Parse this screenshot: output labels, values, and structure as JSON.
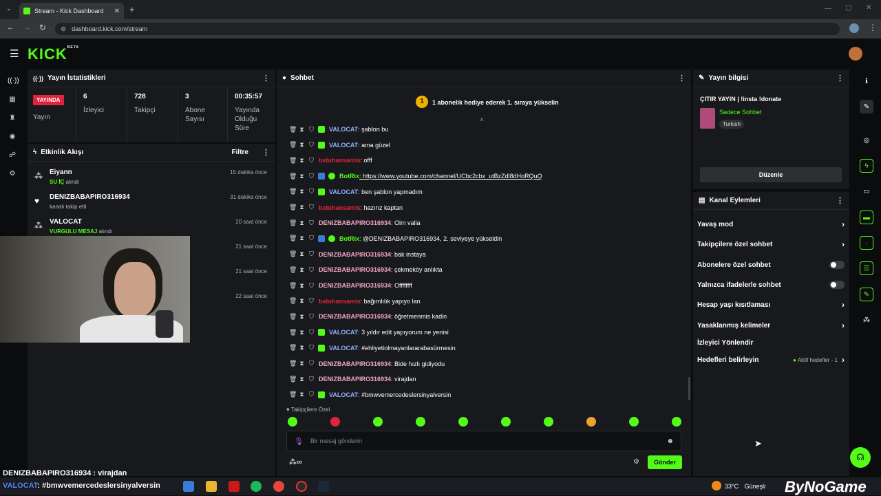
{
  "browser": {
    "tab_title": "Stream - Kick Dashboard",
    "url": "dashboard.kick.com/stream"
  },
  "brand": {
    "logo": "KICK",
    "beta": "BETA",
    "accent": "#53fc18"
  },
  "stats": {
    "title": "Yayın İstatistikleri",
    "live_badge": "YAYINDA",
    "live_label": "Yayın",
    "cells": [
      {
        "value": "6",
        "label": "İzleyici"
      },
      {
        "value": "728",
        "label": "Takipçi"
      },
      {
        "value": "3",
        "label": "Abone Sayısı"
      },
      {
        "value": "00:35:57",
        "label": "Yayında Olduğu Süre"
      }
    ]
  },
  "activity": {
    "title": "Etkinlik Akışı",
    "filter": "Filtre",
    "items": [
      {
        "name": "Eiyann",
        "highlight": "SU İÇ",
        "desc": " alındı",
        "time": "15 dakika önce"
      },
      {
        "name": "DENIZBABAPIRO316934",
        "highlight": "",
        "desc": "kanalı takip etti",
        "time": "31 dakika önce"
      },
      {
        "name": "VALOCAT",
        "highlight": "VURGULU MESAJ",
        "desc": " alındı",
        "time": "20 saat önce"
      },
      {
        "name": "",
        "highlight": "",
        "desc": "",
        "time": "21 saat önce"
      },
      {
        "name": "",
        "highlight": "",
        "desc": "",
        "time": "21 saat önce"
      },
      {
        "name": "",
        "highlight": "",
        "desc": "",
        "time": "22 saat önce"
      }
    ]
  },
  "chat": {
    "title": "Sohbet",
    "pinned_rank": "1",
    "pinned_text": "1 abonelik hediye ederek 1. sıraya yükselin",
    "messages": [
      {
        "user": "VALOCAT",
        "color": "#8fb4ff",
        "badge": "sub",
        "text": ": şablon bu"
      },
      {
        "user": "VALOCAT",
        "color": "#8fb4ff",
        "badge": "sub",
        "text": ": ama güzel"
      },
      {
        "user": "batuhansamis",
        "color": "#e0233d",
        "badge": "",
        "text": ": offf"
      },
      {
        "user": "BotRix",
        "color": "#53fc18",
        "badge": "bot",
        "text": ": https://www.youtube.com/channel/UCbc2cbx_utBzZdl8dHoRQuQ"
      },
      {
        "user": "VALOCAT",
        "color": "#8fb4ff",
        "badge": "sub",
        "text": ": ben şablon yapmadım"
      },
      {
        "user": "batuhansamis",
        "color": "#e0233d",
        "badge": "",
        "text": ": hazırız kaptan"
      },
      {
        "user": "DENIZBABAPIRO316934",
        "color": "#f2a6c4",
        "badge": "",
        "text": ": Olm valla"
      },
      {
        "user": "BotRix",
        "color": "#53fc18",
        "badge": "bot",
        "text": ": @DENIZBABAPIRO316934, 2. seviyeye yükseldin"
      },
      {
        "user": "DENIZBABAPIRO316934",
        "color": "#f2a6c4",
        "badge": "",
        "text": ": bak instaya"
      },
      {
        "user": "DENIZBABAPIRO316934",
        "color": "#f2a6c4",
        "badge": "",
        "text": ": çekmeköy anlıkta"
      },
      {
        "user": "DENIZBABAPIRO316934",
        "color": "#f2a6c4",
        "badge": "",
        "text": ": Offffffff"
      },
      {
        "user": "batuhansamis",
        "color": "#e0233d",
        "badge": "",
        "text": ": bağımlılık yapıyo lan"
      },
      {
        "user": "DENIZBABAPIRO316934",
        "color": "#f2a6c4",
        "badge": "",
        "text": ": öğretmenmis kadin"
      },
      {
        "user": "VALOCAT",
        "color": "#8fb4ff",
        "badge": "sub",
        "text": ": 3 yıldır edit yapıyorum ne yenisi"
      },
      {
        "user": "VALOCAT",
        "color": "#8fb4ff",
        "badge": "sub",
        "text": ": #ehliyetiolmayanlararabasürmesin"
      },
      {
        "user": "DENIZBABAPIRO316934",
        "color": "#f2a6c4",
        "badge": "",
        "text": ": Bide hızlı gidiyodu"
      },
      {
        "user": "DENIZBABAPIRO316934",
        "color": "#f2a6c4",
        "badge": "",
        "text": ": virajdan"
      },
      {
        "user": "VALOCAT",
        "color": "#8fb4ff",
        "badge": "sub",
        "text": ": #bmwvemercedeslersinyalversin"
      }
    ],
    "followers_only": "Takipçilere Özel",
    "input_placeholder": "Bir mesaj gönderin",
    "send": "Gönder",
    "infinity": "∞"
  },
  "stream_info": {
    "title": "Yayın bilgisi",
    "stream_title": "ÇITIR YAYIN | !insta !donate",
    "category": "Sadece Sohbet",
    "language": "Turkish",
    "edit": "Düzenle"
  },
  "channel_actions": {
    "title": "Kanal Eylemleri",
    "items": [
      {
        "label": "Yavaş mod",
        "control": "chevron"
      },
      {
        "label": "Takipçilere özel sohbet",
        "control": "chevron"
      },
      {
        "label": "Abonelere özel sohbet",
        "control": "toggle"
      },
      {
        "label": "Yalnızca ifadelerle sohbet",
        "control": "toggle"
      },
      {
        "label": "Hesap yaşı kısıtlaması",
        "control": "chevron"
      },
      {
        "label": "Yasaklanmış kelimeler",
        "control": "chevron"
      },
      {
        "label": "İzleyici Yönlendir",
        "control": "none"
      },
      {
        "label": "Hedefleri belirleyin",
        "control": "chevron"
      }
    ],
    "goals_status": "Aktif hedefler - 1"
  },
  "overlay": {
    "line1_user": "DENIZBABAPIRO316934",
    "line1_text": " : virajdan",
    "line2_user": "VALOCAT",
    "line2_text": ": #bmwvemercedeslersinyalversin",
    "watermark": "ByNoGame"
  },
  "taskbar": {
    "weather": "33°C",
    "weather_label": "Güneşli"
  }
}
